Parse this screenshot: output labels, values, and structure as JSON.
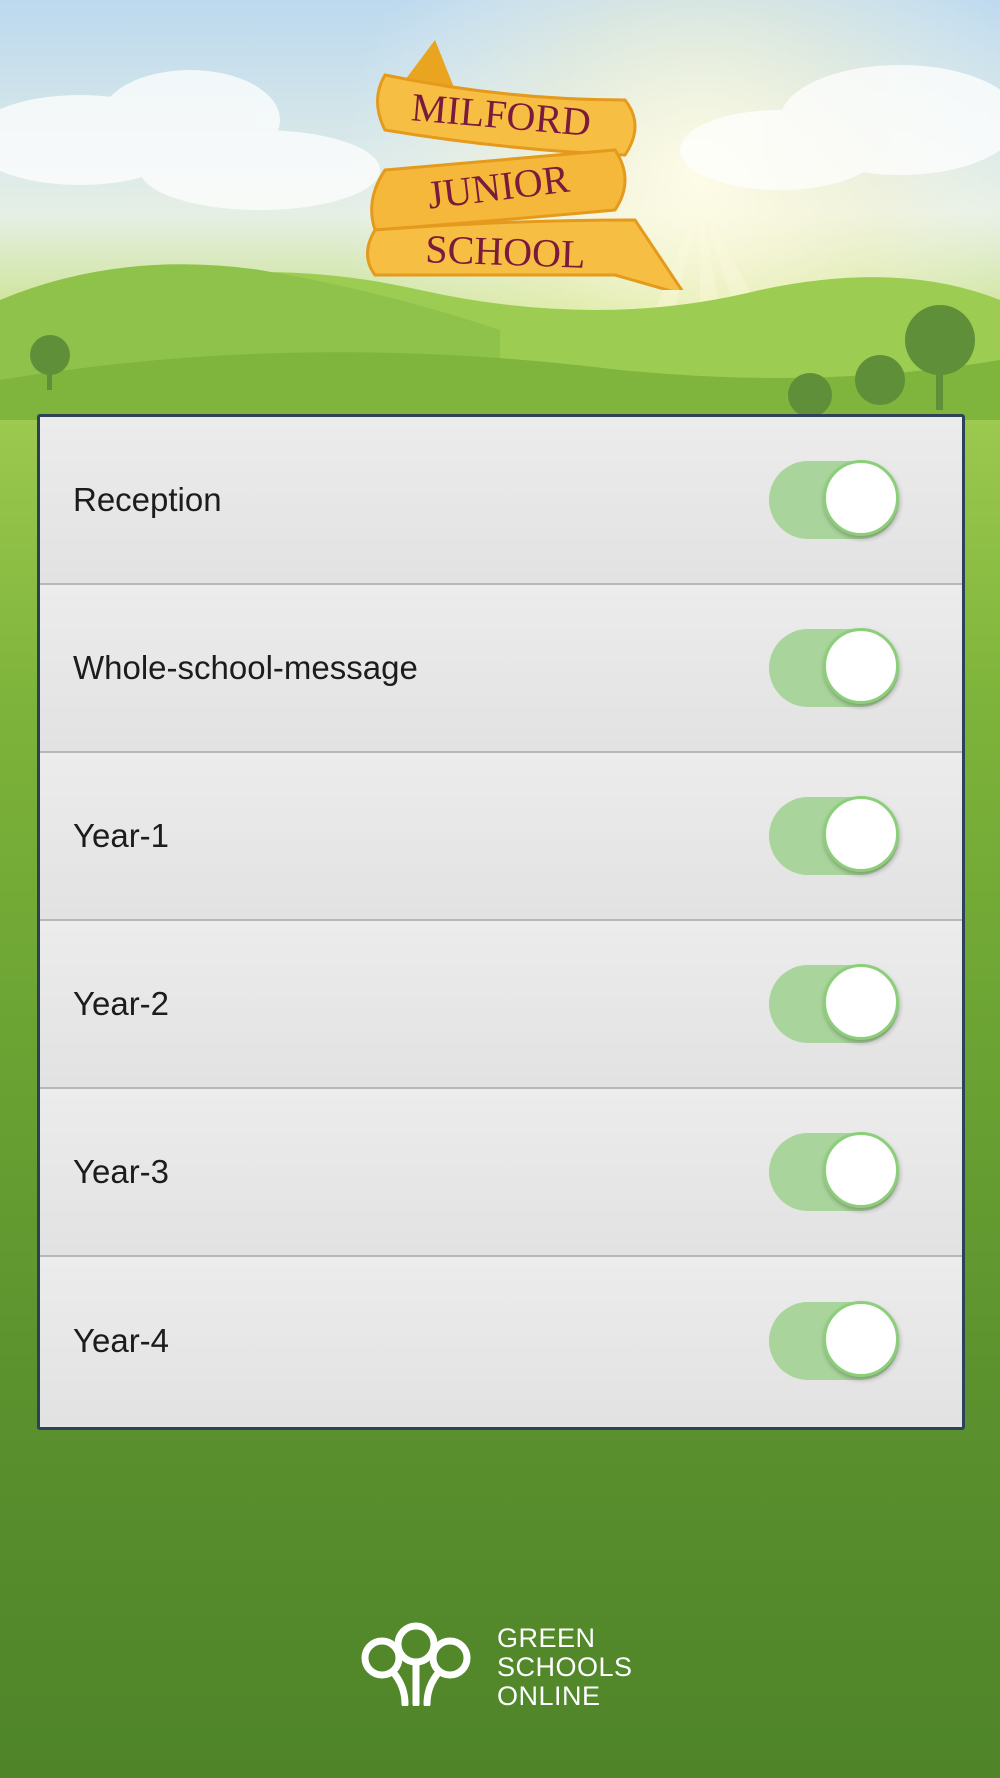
{
  "header": {
    "logo": {
      "line1": "MILFORD",
      "line2": "JUNIOR",
      "line3": "SCHOOL"
    }
  },
  "settings": {
    "items": [
      {
        "label": "Reception",
        "enabled": true
      },
      {
        "label": "Whole-school-message",
        "enabled": true
      },
      {
        "label": "Year-1",
        "enabled": true
      },
      {
        "label": "Year-2",
        "enabled": true
      },
      {
        "label": "Year-3",
        "enabled": true
      },
      {
        "label": "Year-4",
        "enabled": true
      }
    ]
  },
  "footer": {
    "brand_line1": "GREEN",
    "brand_line2": "SCHOOLS",
    "brand_line3": "ONLINE",
    "icon": "tree-people-icon"
  },
  "colors": {
    "toggle_track": "#a9d49b",
    "toggle_knob": "#ffffff",
    "panel_border": "#2d4258",
    "ribbon": "#f5b83a",
    "ribbon_text": "#7a1a3c"
  }
}
